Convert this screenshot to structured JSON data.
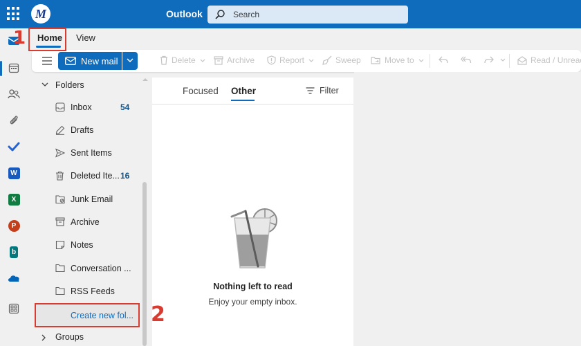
{
  "app": {
    "title": "Outlook",
    "logo_letter": "M"
  },
  "search": {
    "placeholder": "Search"
  },
  "ribbon_tabs": {
    "home": "Home",
    "view": "View"
  },
  "ribbon": {
    "new_mail": "New mail",
    "delete": "Delete",
    "archive": "Archive",
    "report": "Report",
    "sweep": "Sweep",
    "move_to": "Move to",
    "read_unread": "Read / Unread"
  },
  "folders": {
    "header": "Folders",
    "items": [
      {
        "label": "Inbox",
        "count": "54",
        "icon": "inbox-icon"
      },
      {
        "label": "Drafts",
        "count": "",
        "icon": "drafts-icon"
      },
      {
        "label": "Sent Items",
        "count": "",
        "icon": "send-icon"
      },
      {
        "label": "Deleted Ite...",
        "count": "16",
        "icon": "trash-icon"
      },
      {
        "label": "Junk Email",
        "count": "",
        "icon": "junk-icon"
      },
      {
        "label": "Archive",
        "count": "",
        "icon": "archive-icon"
      },
      {
        "label": "Notes",
        "count": "",
        "icon": "notes-icon"
      },
      {
        "label": "Conversation ...",
        "count": "",
        "icon": "folder-icon"
      },
      {
        "label": "RSS Feeds",
        "count": "",
        "icon": "folder-icon"
      }
    ],
    "create_new": "Create new fol...",
    "groups_header": "Groups"
  },
  "message_list": {
    "tab_focused": "Focused",
    "tab_other": "Other",
    "filter": "Filter",
    "empty_title": "Nothing left to read",
    "empty_subtitle": "Enjoy your empty inbox."
  },
  "annotations": {
    "step1": "1",
    "step2": "2"
  },
  "colors": {
    "brand": "#0f6cbd",
    "annotation": "#d83b30",
    "word": "#185abd",
    "excel": "#107c41",
    "powerpoint": "#c43e1c",
    "bookings": "#03787c",
    "onedrive": "#0364b8"
  }
}
